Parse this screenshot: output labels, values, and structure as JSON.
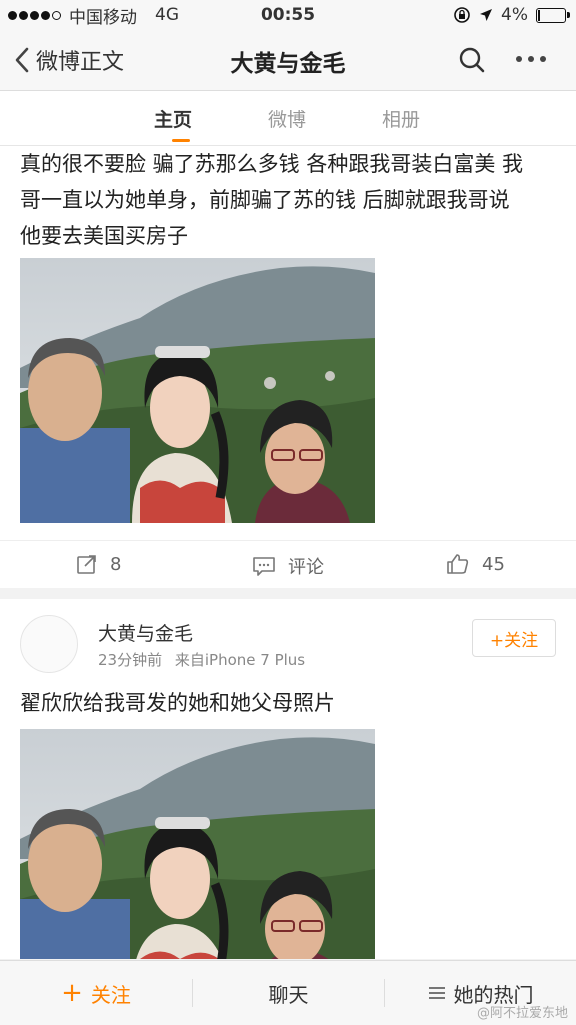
{
  "status": {
    "carrier": "中国移动",
    "network": "4G",
    "time": "00:55",
    "battery": "4%",
    "battery_level": 0.04
  },
  "nav": {
    "back_label": "微博正文",
    "title": "大黄与金毛"
  },
  "tabs": [
    {
      "label": "主页"
    },
    {
      "label": "微博"
    },
    {
      "label": "相册"
    }
  ],
  "post1": {
    "lines": [
      "真的很不要脸 骗了苏那么多钱 各种跟我哥装白富美 我",
      "哥一直以为她单身，前脚骗了苏的钱 后脚就跟我哥说",
      "他要去美国买房子"
    ],
    "reposts": "8",
    "comment_label": "评论",
    "likes": "45"
  },
  "post2": {
    "author": "大黄与金毛",
    "time_ago": "23分钟前",
    "source": "来自iPhone 7 Plus",
    "follow_label": "+关注",
    "text": "翟欣欣给我哥发的她和她父母照片"
  },
  "bottom": {
    "follow_label": "关注",
    "chat_label": "聊天",
    "hot_label": "她的热门"
  },
  "watermark": "@阿不拉爱东地",
  "colors": {
    "accent": "#ff8200",
    "text": "#333333",
    "muted": "#999999"
  }
}
